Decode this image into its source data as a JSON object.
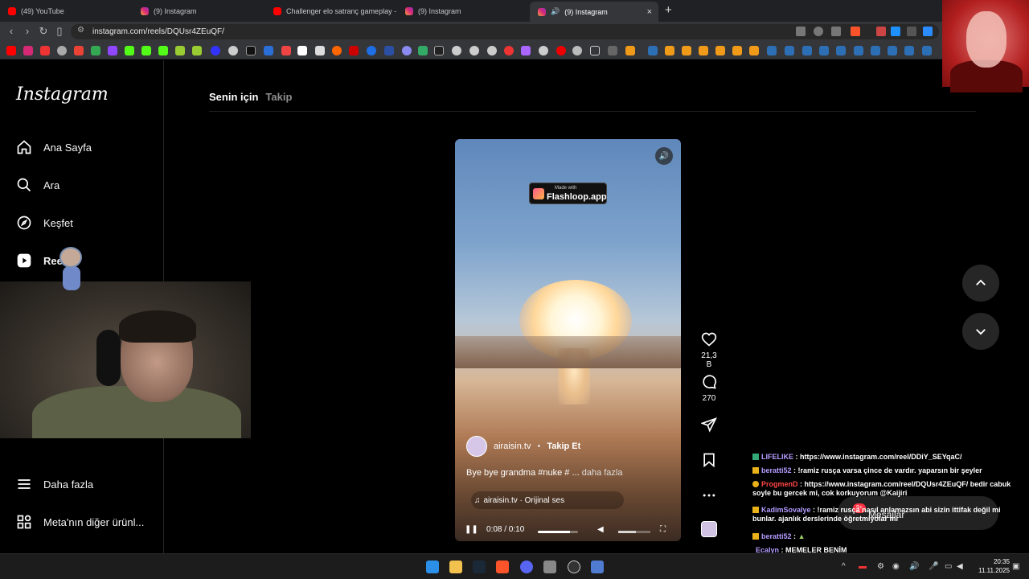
{
  "browser": {
    "tabs": [
      {
        "label": "(49) YouTube",
        "icon": "youtube-icon"
      },
      {
        "label": "(9) Instagram",
        "icon": "instagram-icon"
      },
      {
        "label": "Challenger elo satranç gameplay - Yo",
        "icon": "youtube-icon"
      },
      {
        "label": "(9) Instagram",
        "icon": "instagram-icon"
      },
      {
        "label": "(9) Instagram",
        "icon": "instagram-icon"
      }
    ],
    "close_glyph": "×",
    "new_tab_glyph": "+",
    "url": "instagram.com/reels/DQUsr4ZEuQF/"
  },
  "instagram": {
    "logo": "Instagram",
    "nav": {
      "home": "Ana Sayfa",
      "search": "Ara",
      "explore": "Keşfet",
      "reels": "Reels",
      "more": "Daha fazla",
      "meta": "Meta'nın diğer ürünl..."
    },
    "tabs": {
      "for_you": "Senin için",
      "following": "Takip"
    },
    "reel": {
      "badge_small": "Made with",
      "badge_big": "Flashloop.app",
      "author": "airaisin.tv",
      "dot": "•",
      "follow": "Takip Et",
      "caption": "Bye bye grandma #nuke # ...",
      "caption_more": "daha fazla",
      "audio": "airaisin.tv · Orijinal ses",
      "time": "0:08 / 0:10",
      "progress": 0.8,
      "likes": "21,3 B",
      "comments": "270"
    },
    "messages": {
      "label": "Mesajlar",
      "count": "9+"
    }
  },
  "chat": [
    {
      "user": "LIFELIKE",
      "text": ": https://www.instagram.com/reel/DDiY_SEYqaC/",
      "color": "#b49cff"
    },
    {
      "user": "beratti52",
      "text": ": !ramiz rusça varsa çince de vardır. yaparsın bir şeyler",
      "color": "#b49cff"
    },
    {
      "user": "ProgmenD",
      "text": ": https://www.instagram.com/reel/DQUsr4ZEuQF/ bedir cabuk soyle bu gercek mi, cok korkuyorum @Kaijiri",
      "color": "#ff4646"
    },
    {
      "user": "KadimSovalye",
      "text": ": !ramiz rusça nasıl anlamazsın abi sizin ittifak değil mi bunlar. ajanlık derslerinde öğretmiyolar mı",
      "color": "#b49cff"
    },
    {
      "user": "beratti52",
      "text": ":",
      "color": "#b49cff"
    },
    {
      "user": "Ecalyn",
      "text": ": MEMELER BENİM",
      "color": "#b49cff"
    }
  ],
  "taskbar": {
    "time": "20:35",
    "date": "11.11.2025"
  },
  "colors": {
    "accent_red": "#ff3040",
    "sidebar_border": "#262626"
  }
}
